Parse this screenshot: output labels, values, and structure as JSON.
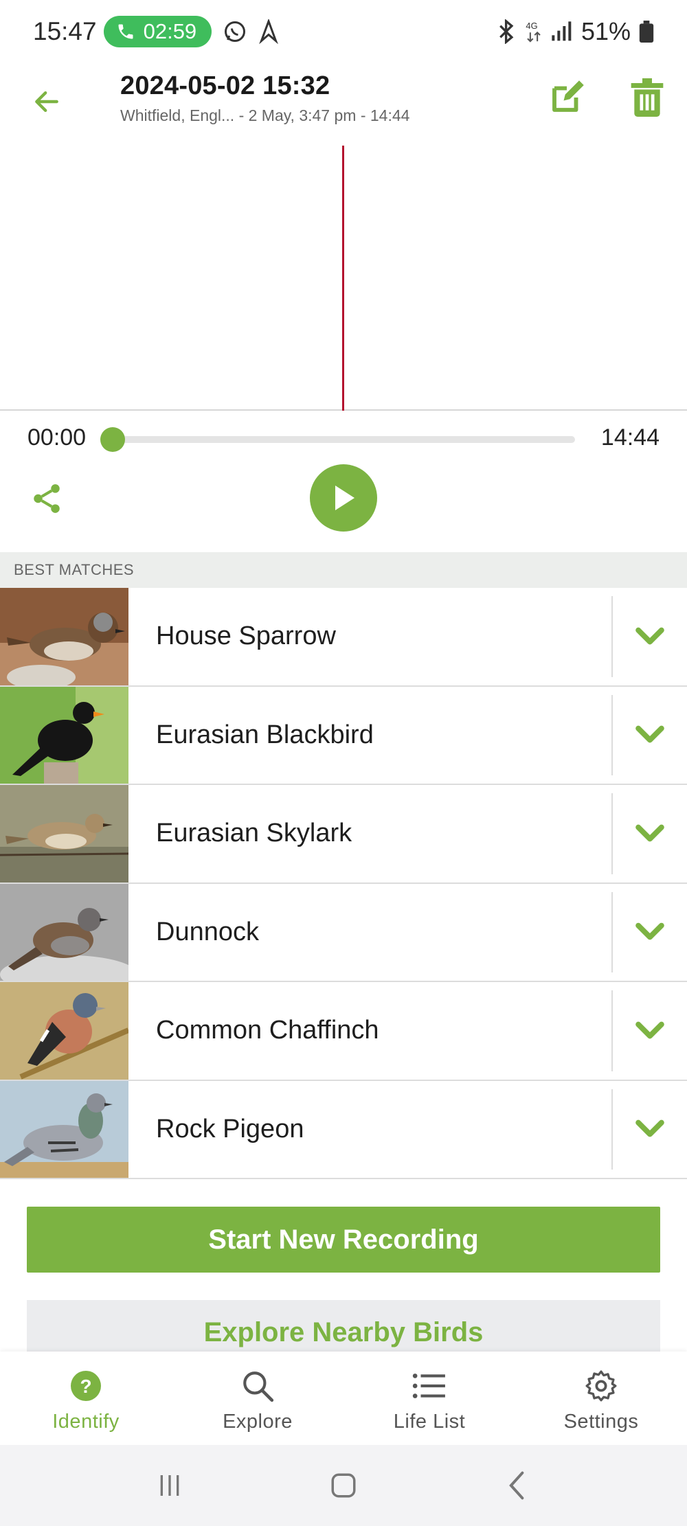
{
  "status_bar": {
    "time": "15:47",
    "call_timer": "02:59",
    "battery": "51%",
    "network": "4G"
  },
  "header": {
    "title": "2024-05-02 15:32",
    "subtitle": "Whitfield, Engl... - 2 May, 3:47 pm - 14:44"
  },
  "player": {
    "current_time": "00:00",
    "total_time": "14:44",
    "progress": 0.0
  },
  "matches": {
    "section_title": "BEST MATCHES",
    "items": [
      {
        "name": "House Sparrow"
      },
      {
        "name": "Eurasian Blackbird"
      },
      {
        "name": "Eurasian Skylark"
      },
      {
        "name": "Dunnock"
      },
      {
        "name": "Common Chaffinch"
      },
      {
        "name": "Rock Pigeon"
      }
    ]
  },
  "actions": {
    "start_recording": "Start New Recording",
    "explore_nearby": "Explore Nearby Birds"
  },
  "nav": {
    "items": [
      {
        "label": "Identify",
        "icon": "question-circle-icon",
        "active": true
      },
      {
        "label": "Explore",
        "icon": "search-icon",
        "active": false
      },
      {
        "label": "Life List",
        "icon": "list-icon",
        "active": false
      },
      {
        "label": "Settings",
        "icon": "gear-icon",
        "active": false
      }
    ]
  },
  "colors": {
    "accent": "#7cb342",
    "playhead": "#b3122e",
    "call_pill": "#3fbd5c"
  }
}
